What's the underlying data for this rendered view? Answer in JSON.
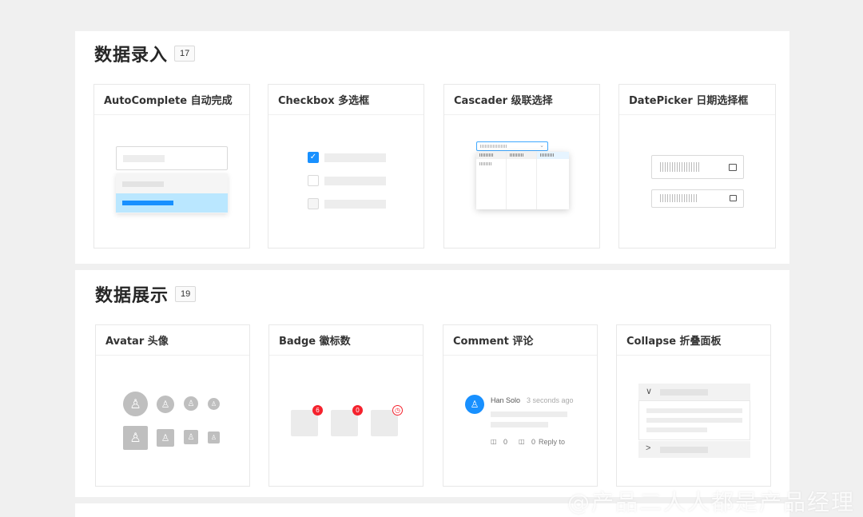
{
  "sections": [
    {
      "title": "数据录入",
      "count": "17",
      "cards": [
        {
          "label": "AutoComplete 自动完成"
        },
        {
          "label": "Checkbox 多选框"
        },
        {
          "label": "Cascader 级联选择"
        },
        {
          "label": "DatePicker 日期选择框"
        }
      ]
    },
    {
      "title": "数据展示",
      "count": "19",
      "cards": [
        {
          "label": "Avatar 头像"
        },
        {
          "label": "Badge 徽标数"
        },
        {
          "label": "Comment 评论"
        },
        {
          "label": "Collapse 折叠面板"
        }
      ]
    }
  ],
  "badge": {
    "counts": [
      "6",
      "0"
    ],
    "clock_glyph": "◷"
  },
  "comment": {
    "author": "Han Solo",
    "time": "3 seconds ago",
    "likes": "0",
    "dislikes": "0",
    "reply": "Reply to"
  },
  "icons": {
    "check": "✓",
    "calendar": "calendar-icon",
    "user": "user-icon",
    "chevron_down": "∨",
    "chevron_right": ">",
    "thumbs_up": "👍",
    "thumbs_down": "👎"
  },
  "colors": {
    "primary": "#1890ff",
    "selected_bg": "#bae7ff",
    "badge_red": "#f5222d",
    "avatar_gray": "#bfbfbf"
  },
  "watermark": "@产品二人人都是产品经理"
}
